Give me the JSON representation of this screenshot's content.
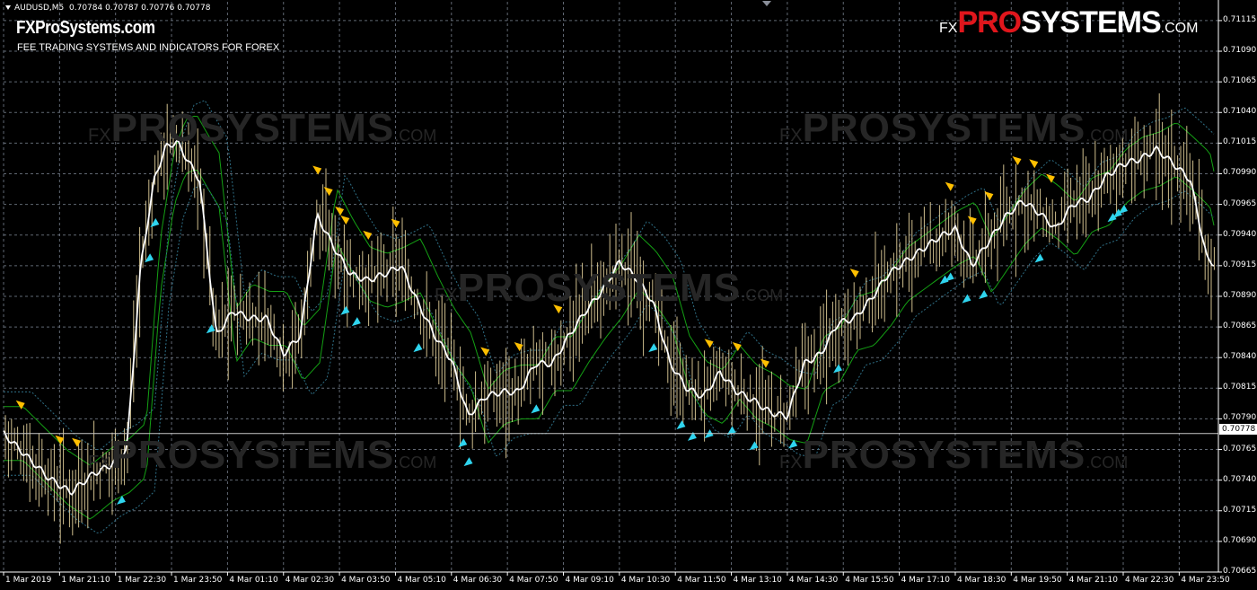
{
  "header": {
    "symbol": "AUDUSD,M5",
    "quotes": "0.70784 0.70787 0.70776 0.70778"
  },
  "site": {
    "title": "FXProSystems.com",
    "subtitle": "FEE TRADING SYSTEMS AND INDICATORS FOR FOREX"
  },
  "logo": {
    "fx": "FX",
    "pro": "PRO",
    "systems": "SYSTEMS",
    "com": ".COM"
  },
  "watermark": {
    "fx": "FX",
    "main": "PROSYSTEMS",
    "com": ".COM"
  },
  "current_price": "0.70778",
  "colors": {
    "background": "#000000",
    "candles": "#f2dfa6",
    "moving_average": "#ffffff",
    "band_inner": "#14a014",
    "band_outer": "#2e6f86",
    "sell_arrow": "#ffbf00",
    "buy_arrow": "#2fd4ee",
    "logo_red": "#e0161c"
  },
  "chart_data": {
    "type": "line",
    "symbol": "AUDUSD",
    "timeframe": "M5",
    "ylim": [
      0.70665,
      0.71123
    ],
    "y_ticks": [
      "0.71115",
      "0.71090",
      "0.71065",
      "0.71040",
      "0.71015",
      "0.70990",
      "0.70965",
      "0.70940",
      "0.70915",
      "0.70890",
      "0.70865",
      "0.70840",
      "0.70815",
      "0.70790",
      "0.70765",
      "0.70740",
      "0.70715",
      "0.70690",
      "0.70665"
    ],
    "x_ticks": [
      "1 Mar 2019",
      "1 Mar 21:10",
      "1 Mar 22:30",
      "1 Mar 23:50",
      "4 Mar 01:10",
      "4 Mar 02:30",
      "4 Mar 03:50",
      "4 Mar 05:10",
      "4 Mar 06:30",
      "4 Mar 07:50",
      "4 Mar 09:10",
      "4 Mar 10:30",
      "4 Mar 11:50",
      "4 Mar 13:10",
      "4 Mar 14:30",
      "4 Mar 15:50",
      "4 Mar 17:10",
      "4 Mar 18:30",
      "4 Mar 19:50",
      "4 Mar 21:10",
      "4 Mar 22:30",
      "4 Mar 23:50"
    ],
    "grid": true,
    "last_price": 0.70778,
    "series": [
      {
        "kind": "moving_average",
        "x": [
          0,
          0.4,
          0.8,
          1.2,
          1.6,
          1.9,
          2.2,
          2.45,
          2.7,
          2.9,
          3.1,
          3.3,
          3.5,
          3.8,
          4.1,
          4.4,
          4.7,
          5.0,
          5.3,
          5.6,
          5.9,
          6.2,
          6.5,
          6.8,
          7.1,
          7.4,
          7.7,
          8.0,
          8.3,
          8.6,
          8.9,
          9.2,
          9.5,
          9.8,
          10.1,
          10.4,
          10.7,
          11.0,
          11.3,
          11.6,
          11.9,
          12.2,
          12.5,
          12.8,
          13.1,
          13.4,
          13.7,
          14.0,
          14.3,
          14.6,
          14.9,
          15.2,
          15.5,
          15.8,
          16.1,
          16.4,
          16.7,
          17.0,
          17.3,
          17.6,
          17.9,
          18.2,
          18.5,
          18.8,
          19.1,
          19.4,
          19.7,
          20.0,
          20.3,
          20.6,
          20.9,
          21.2,
          21.5,
          21.7
        ],
        "values": [
          0.70778,
          0.7076,
          0.70742,
          0.7073,
          0.70745,
          0.70752,
          0.70765,
          0.70915,
          0.70987,
          0.71012,
          0.71016,
          0.71,
          0.70985,
          0.70858,
          0.70878,
          0.70872,
          0.70872,
          0.70843,
          0.70858,
          0.70956,
          0.7093,
          0.70908,
          0.70903,
          0.70908,
          0.70915,
          0.70885,
          0.70858,
          0.70838,
          0.70792,
          0.70808,
          0.70812,
          0.70812,
          0.70835,
          0.70835,
          0.70858,
          0.70878,
          0.70895,
          0.70918,
          0.70905,
          0.70885,
          0.70836,
          0.70815,
          0.70808,
          0.70828,
          0.70812,
          0.70805,
          0.70795,
          0.70792,
          0.70835,
          0.70843,
          0.70868,
          0.70872,
          0.70888,
          0.70908,
          0.70918,
          0.70928,
          0.70938,
          0.70945,
          0.70915,
          0.70935,
          0.70955,
          0.70968,
          0.70958,
          0.70945,
          0.70965,
          0.7097,
          0.70988,
          0.70998,
          0.71002,
          0.7101,
          0.70998,
          0.70985,
          0.7092,
          0.70915
        ]
      }
    ],
    "sell_arrows_count": 31,
    "buy_arrows_count": 31
  }
}
